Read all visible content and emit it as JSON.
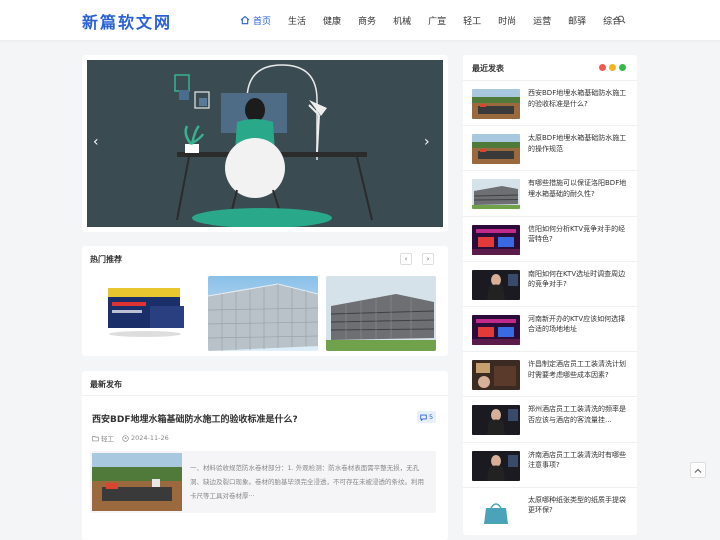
{
  "site": {
    "logo": "新篇软文网"
  },
  "nav": {
    "items": [
      "首页",
      "生活",
      "健康",
      "商务",
      "机械",
      "广宣",
      "轻工",
      "时尚",
      "运营",
      "邮驿",
      "综合"
    ]
  },
  "slider": {
    "prev": "‹",
    "next": "›"
  },
  "hot": {
    "title": "热门推荐",
    "prev": "‹",
    "next": "›"
  },
  "latest": {
    "title": "最新发布",
    "article": {
      "title": "西安BDF地埋水箱基础防水施工的验收标准是什么?",
      "comments": "5",
      "category": "轻工",
      "date": "2024-11-26",
      "excerpt": "一、材料验收规范防水卷材部分：1. 外观检测：防水卷材表面需平整无损，无孔洞、缺边及裂口现象。卷材的胎基毕须完全浸透，不可存在未被浸透的条纹。利用卡尺等工具对卷材厚···"
    }
  },
  "sidebar": {
    "title": "最近发表",
    "dots": [
      "#f15a4f",
      "#f5b21f",
      "#35b94a"
    ],
    "items": [
      {
        "title": "西安BDF地埋水箱基础防水施工的验收标准是什么?",
        "thumb": "site"
      },
      {
        "title": "太原BDF地埋水箱基础防水施工的操作规范",
        "thumb": "site"
      },
      {
        "title": "有哪些措施可以保证洛阳BDF地埋水箱基础的耐久性?",
        "thumb": "building"
      },
      {
        "title": "信阳如何分析KTV竞争对手的经营特色?",
        "thumb": "ktv"
      },
      {
        "title": "南阳如何在KTV选址时调查周边的竞争对手?",
        "thumb": "woman"
      },
      {
        "title": "河南新开办的KTV应该如何选择合适的场地地址",
        "thumb": "ktv"
      },
      {
        "title": "许昌制定酒店员工工装清洗计划时需要考虑哪些成本因素?",
        "thumb": "hotel"
      },
      {
        "title": "郑州酒店员工工装清洗的频率是否应该与酒店的客流量挂...",
        "thumb": "woman"
      },
      {
        "title": "济南酒店员工工装清洗时有哪些注意事项?",
        "thumb": "woman"
      },
      {
        "title": "太原哪种纸张类型的纸质手提袋更环保?",
        "thumb": "bag"
      }
    ]
  }
}
